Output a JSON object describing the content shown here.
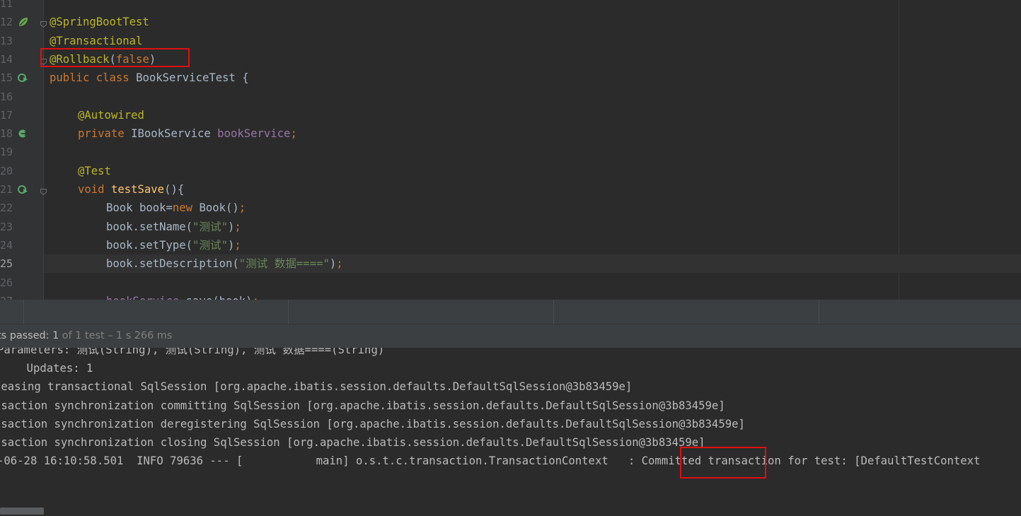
{
  "editor": {
    "current_line": "25",
    "lines": [
      {
        "num": "11",
        "tokens": []
      },
      {
        "num": "12",
        "tokens": [
          {
            "t": "@SpringBootTest",
            "c": "ann"
          }
        ],
        "icon": "leaf-icon",
        "fold": true
      },
      {
        "num": "13",
        "tokens": [
          {
            "t": "@Transactional",
            "c": "ann"
          }
        ]
      },
      {
        "num": "14",
        "tokens": [
          {
            "t": "@Rollback",
            "c": "ann"
          },
          {
            "t": "(",
            "c": ""
          },
          {
            "t": "false",
            "c": "kw"
          },
          {
            "t": ")",
            "c": ""
          }
        ],
        "fold": true
      },
      {
        "num": "15",
        "tokens": [
          {
            "t": "public class ",
            "c": "kw"
          },
          {
            "t": "BookServiceTest {",
            "c": ""
          }
        ],
        "icon": "run-test-icon"
      },
      {
        "num": "16",
        "tokens": []
      },
      {
        "num": "17",
        "tokens": [
          {
            "t": "@Autowired",
            "c": "ann"
          }
        ],
        "indent": 1
      },
      {
        "num": "18",
        "tokens": [
          {
            "t": "private ",
            "c": "kw"
          },
          {
            "t": "IBookService ",
            "c": ""
          },
          {
            "t": "bookService",
            "c": "fld"
          },
          {
            "t": ";",
            "c": "kw"
          }
        ],
        "indent": 1,
        "icon": "bean-navigate-icon"
      },
      {
        "num": "19",
        "tokens": []
      },
      {
        "num": "20",
        "tokens": [
          {
            "t": "@Test",
            "c": "ann"
          }
        ],
        "indent": 1
      },
      {
        "num": "21",
        "tokens": [
          {
            "t": "void ",
            "c": "kw"
          },
          {
            "t": "testSave",
            "c": "mth"
          },
          {
            "t": "(){",
            "c": ""
          }
        ],
        "indent": 1,
        "icon": "run-test-icon",
        "fold": true
      },
      {
        "num": "22",
        "tokens": [
          {
            "t": "Book book=",
            "c": ""
          },
          {
            "t": "new ",
            "c": "kw"
          },
          {
            "t": "Book()",
            "c": ""
          },
          {
            "t": ";",
            "c": "kw"
          }
        ],
        "indent": 2
      },
      {
        "num": "23",
        "tokens": [
          {
            "t": "book.setName(",
            "c": ""
          },
          {
            "t": "\"测试\"",
            "c": "str"
          },
          {
            "t": ")",
            "c": ""
          },
          {
            "t": ";",
            "c": "kw"
          }
        ],
        "indent": 2
      },
      {
        "num": "24",
        "tokens": [
          {
            "t": "book.setType(",
            "c": ""
          },
          {
            "t": "\"测试\"",
            "c": "str"
          },
          {
            "t": ")",
            "c": ""
          },
          {
            "t": ";",
            "c": "kw"
          }
        ],
        "indent": 2
      },
      {
        "num": "25",
        "tokens": [
          {
            "t": "book.setDescription(",
            "c": ""
          },
          {
            "t": "\"测试 数据====\"",
            "c": "str"
          },
          {
            "t": ")",
            "c": ""
          },
          {
            "t": ";",
            "c": "kw"
          }
        ],
        "indent": 2
      },
      {
        "num": "26",
        "tokens": []
      },
      {
        "num": "27",
        "tokens": [
          {
            "t": "bookService",
            "c": "fld"
          },
          {
            "t": ".save(book)",
            "c": ""
          },
          {
            "t": ";",
            "c": "kw"
          }
        ],
        "indent": 2
      }
    ]
  },
  "status": {
    "main": "ts passed: 1",
    "detail": " of 1 test – 1 s 266 ms"
  },
  "console": {
    "lines": [
      {
        "x": -4,
        "t": "Parameters: 测试(String), 测试(String), 测试 数据====(String)"
      },
      {
        "x": 0,
        "t": "    Updates: 1"
      },
      {
        "x": -8,
        "t": "leasing transactional SqlSession [org.apache.ibatis.session.defaults.DefaultSqlSession@3b83459e]"
      },
      {
        "x": -8,
        "t": "nsaction synchronization committing SqlSession [org.apache.ibatis.session.defaults.DefaultSqlSession@3b83459e]"
      },
      {
        "x": -8,
        "t": "nsaction synchronization deregistering SqlSession [org.apache.ibatis.session.defaults.DefaultSqlSession@3b83459e]"
      },
      {
        "x": -8,
        "t": "nsaction synchronization closing SqlSession [org.apache.ibatis.session.defaults.DefaultSqlSession@3b83459e]"
      },
      {
        "x": -4,
        "t": "-06-28 16:10:58.501  INFO 79636 --- [           main] o.s.t.c.transaction.TransactionContext   : Committed transaction for test: [DefaultTestContext"
      }
    ]
  }
}
